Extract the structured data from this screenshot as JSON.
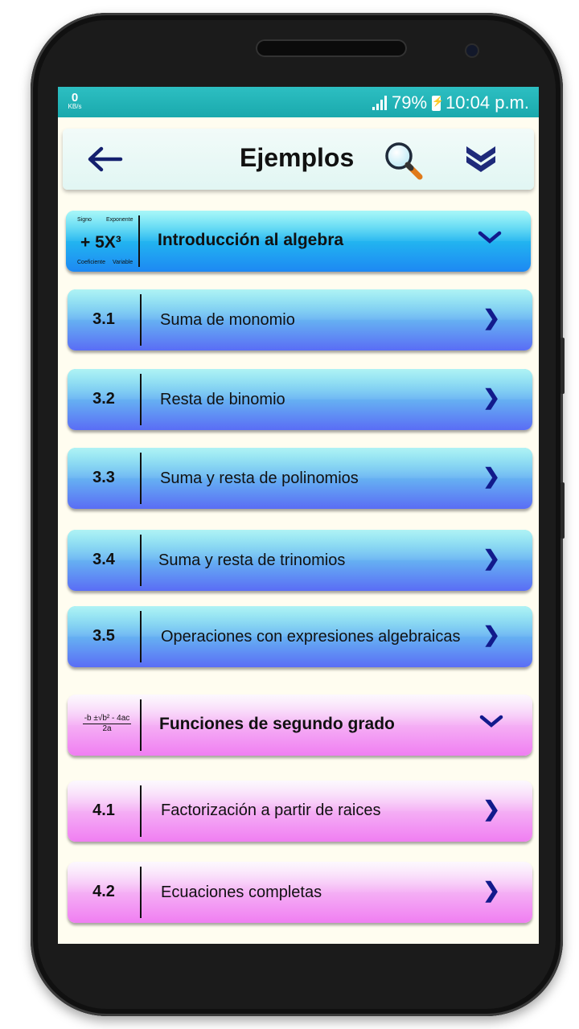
{
  "status_bar": {
    "speed_value": "0",
    "speed_unit": "KB/s",
    "battery": "79%",
    "time": "10:04 p.m."
  },
  "app_bar": {
    "title": "Ejemplos",
    "back_icon": "arrow-left-icon",
    "search_icon": "search-icon",
    "collapse_icon": "double-chevron-down-icon"
  },
  "sections": [
    {
      "header": "Introducción al algebra",
      "thumb": {
        "expression": "+ 5X³",
        "labels": [
          "Signo",
          "Exponente",
          "Coeficiente",
          "Variable"
        ]
      },
      "items": [
        {
          "num": "3.1",
          "label": "Suma de monomio"
        },
        {
          "num": "3.2",
          "label": "Resta de binomio"
        },
        {
          "num": "3.3",
          "label": "Suma y resta de polinomios"
        },
        {
          "num": "3.4",
          "label": "Suma y resta de trinomios"
        },
        {
          "num": "3.5",
          "label": "Operaciones con expresiones algebraicas"
        }
      ]
    },
    {
      "header": "Funciones de segundo grado",
      "thumb": {
        "numerator": "-b ±√b² - 4ac",
        "denominator": "2a"
      },
      "items": [
        {
          "num": "4.1",
          "label": "Factorización a partir de raices"
        },
        {
          "num": "4.2",
          "label": "Ecuaciones completas"
        }
      ]
    }
  ],
  "colors": {
    "status_bar": "#1aa9ad",
    "chevron": "#121a8c",
    "blue_item": "#5a6df5",
    "pink_item": "#f07ef2"
  }
}
